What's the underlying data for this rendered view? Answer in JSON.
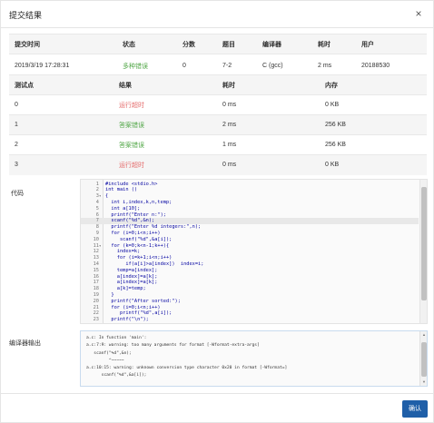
{
  "dialog": {
    "title": "提交结果",
    "close_icon": "×",
    "confirm_label": "确认"
  },
  "summary": {
    "headers": [
      "提交时间",
      "状态",
      "分数",
      "题目",
      "编译器",
      "耗时",
      "用户"
    ],
    "row": {
      "time": "2019/3/19 17:28:31",
      "status": "多种错误",
      "score": "0",
      "problem": "7-2",
      "compiler": "C (gcc)",
      "elapsed": "2 ms",
      "user": "20188530"
    }
  },
  "cases": {
    "headers": [
      "测试点",
      "结果",
      "耗时",
      "内存"
    ],
    "rows": [
      {
        "point": "0",
        "result": "运行超时",
        "time": "0 ms",
        "memory": "0 KB",
        "status": "red"
      },
      {
        "point": "1",
        "result": "答案错误",
        "time": "2 ms",
        "memory": "256 KB",
        "status": "green"
      },
      {
        "point": "2",
        "result": "答案错误",
        "time": "1 ms",
        "memory": "256 KB",
        "status": "green"
      },
      {
        "point": "3",
        "result": "运行超时",
        "time": "0 ms",
        "memory": "0 KB",
        "status": "red"
      }
    ]
  },
  "code": {
    "label": "代码",
    "active_line": 7,
    "lines": [
      {
        "n": "1",
        "fold": "",
        "text": "#include <stdio.h>"
      },
      {
        "n": "2",
        "fold": "",
        "text": "int main ()"
      },
      {
        "n": "3",
        "fold": "▾",
        "text": "{"
      },
      {
        "n": "4",
        "fold": "",
        "text": "  int i,index,k,n,temp;"
      },
      {
        "n": "5",
        "fold": "",
        "text": "  int a[10];"
      },
      {
        "n": "6",
        "fold": "",
        "text": "  printf(\"Enter n:\");"
      },
      {
        "n": "7",
        "fold": "",
        "text": "  scanf(\"%d\",&n);"
      },
      {
        "n": "8",
        "fold": "",
        "text": "  printf(\"Enter %d integers:\",n);"
      },
      {
        "n": "9",
        "fold": "",
        "text": "  for (i=0;i<n;i++)"
      },
      {
        "n": "10",
        "fold": "",
        "text": "     scanf(\"%d\",&a[i]);"
      },
      {
        "n": "11",
        "fold": "▾",
        "text": "  for (k=0;k<n-1;k++){"
      },
      {
        "n": "12",
        "fold": "",
        "text": "    index=k;"
      },
      {
        "n": "13",
        "fold": "",
        "text": "    for (i=k+1;i<n;i++)"
      },
      {
        "n": "14",
        "fold": "",
        "text": "       if(a[i]>a[index])  index=i;"
      },
      {
        "n": "15",
        "fold": "",
        "text": "    temp=a[index];"
      },
      {
        "n": "16",
        "fold": "",
        "text": "    a[index]=a[k];"
      },
      {
        "n": "17",
        "fold": "",
        "text": "    a[index]=a[k];"
      },
      {
        "n": "18",
        "fold": "",
        "text": "    a[k]=temp;"
      },
      {
        "n": "19",
        "fold": "",
        "text": "  }"
      },
      {
        "n": "20",
        "fold": "",
        "text": "  printf(\"After sorted:\");"
      },
      {
        "n": "21",
        "fold": "",
        "text": "  for (i=0;i<n;i++)"
      },
      {
        "n": "22",
        "fold": "",
        "text": "     printf(\"%d\",a[i]);"
      },
      {
        "n": "23",
        "fold": "",
        "text": "  printf(\"\\n\");"
      }
    ]
  },
  "compiler": {
    "label": "编译器输出",
    "lines": [
      "a.c: In function 'main':",
      "a.c:7:9: warning: too many arguments for format [-Wformat-extra-args]",
      "   scanf(\"%d\",&n);",
      "         ^~~~~~",
      "a.c:10:15: warning: unknown conversion type character 0x20 in format [-Wformat=]",
      "      scanf(\"%d\",&a[i]);"
    ]
  }
}
